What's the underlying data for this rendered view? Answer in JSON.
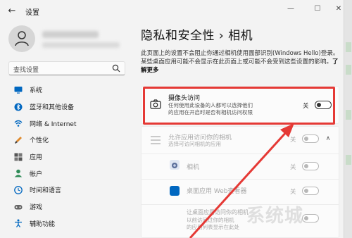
{
  "window": {
    "title": "设置"
  },
  "search": {
    "placeholder": "查找设置"
  },
  "sidebar": {
    "items": [
      {
        "label": "系统",
        "icon": "monitor-icon"
      },
      {
        "label": "蓝牙和其他设备",
        "icon": "bluetooth-icon"
      },
      {
        "label": "网络 & Internet",
        "icon": "wifi-icon"
      },
      {
        "label": "个性化",
        "icon": "brush-icon"
      },
      {
        "label": "应用",
        "icon": "apps-icon"
      },
      {
        "label": "帐户",
        "icon": "person-icon"
      },
      {
        "label": "时间和语言",
        "icon": "clock-globe-icon"
      },
      {
        "label": "游戏",
        "icon": "gamepad-icon"
      },
      {
        "label": "辅助功能",
        "icon": "accessibility-icon"
      }
    ]
  },
  "main": {
    "title": "隐私和安全性  ›  相机",
    "description": "此页面上的设置不会阻止你通过相机使用面部识别(Windows Hello)登录。某些桌面应用可能不会显示在此页面上或可能不会受到这些设置的影响。",
    "learn_more": "了解更多",
    "camera_access": {
      "title": "摄像头访问",
      "subtitle_line1": "任何使用此设备的人都可以选择他们",
      "subtitle_line2": "的应用在开启时是否有相机访问权限",
      "state_label": "关"
    },
    "app_access": {
      "title": "允许应用访问你的相机",
      "subtitle": "选择可访问相机的应用",
      "state_label": "关"
    },
    "apps": [
      {
        "name": "相机",
        "state_label": "关"
      },
      {
        "name": "桌面应用 Web查看器",
        "state_label": "关"
      }
    ],
    "desktop_access": {
      "line1": "让桌面应用访问你的相机",
      "line2": "以前访问过你的相机",
      "line3": "的应用列表显示在此处"
    }
  },
  "colors": {
    "highlight": "#e53935",
    "accent": "#0067c0"
  },
  "watermark": "系统城"
}
